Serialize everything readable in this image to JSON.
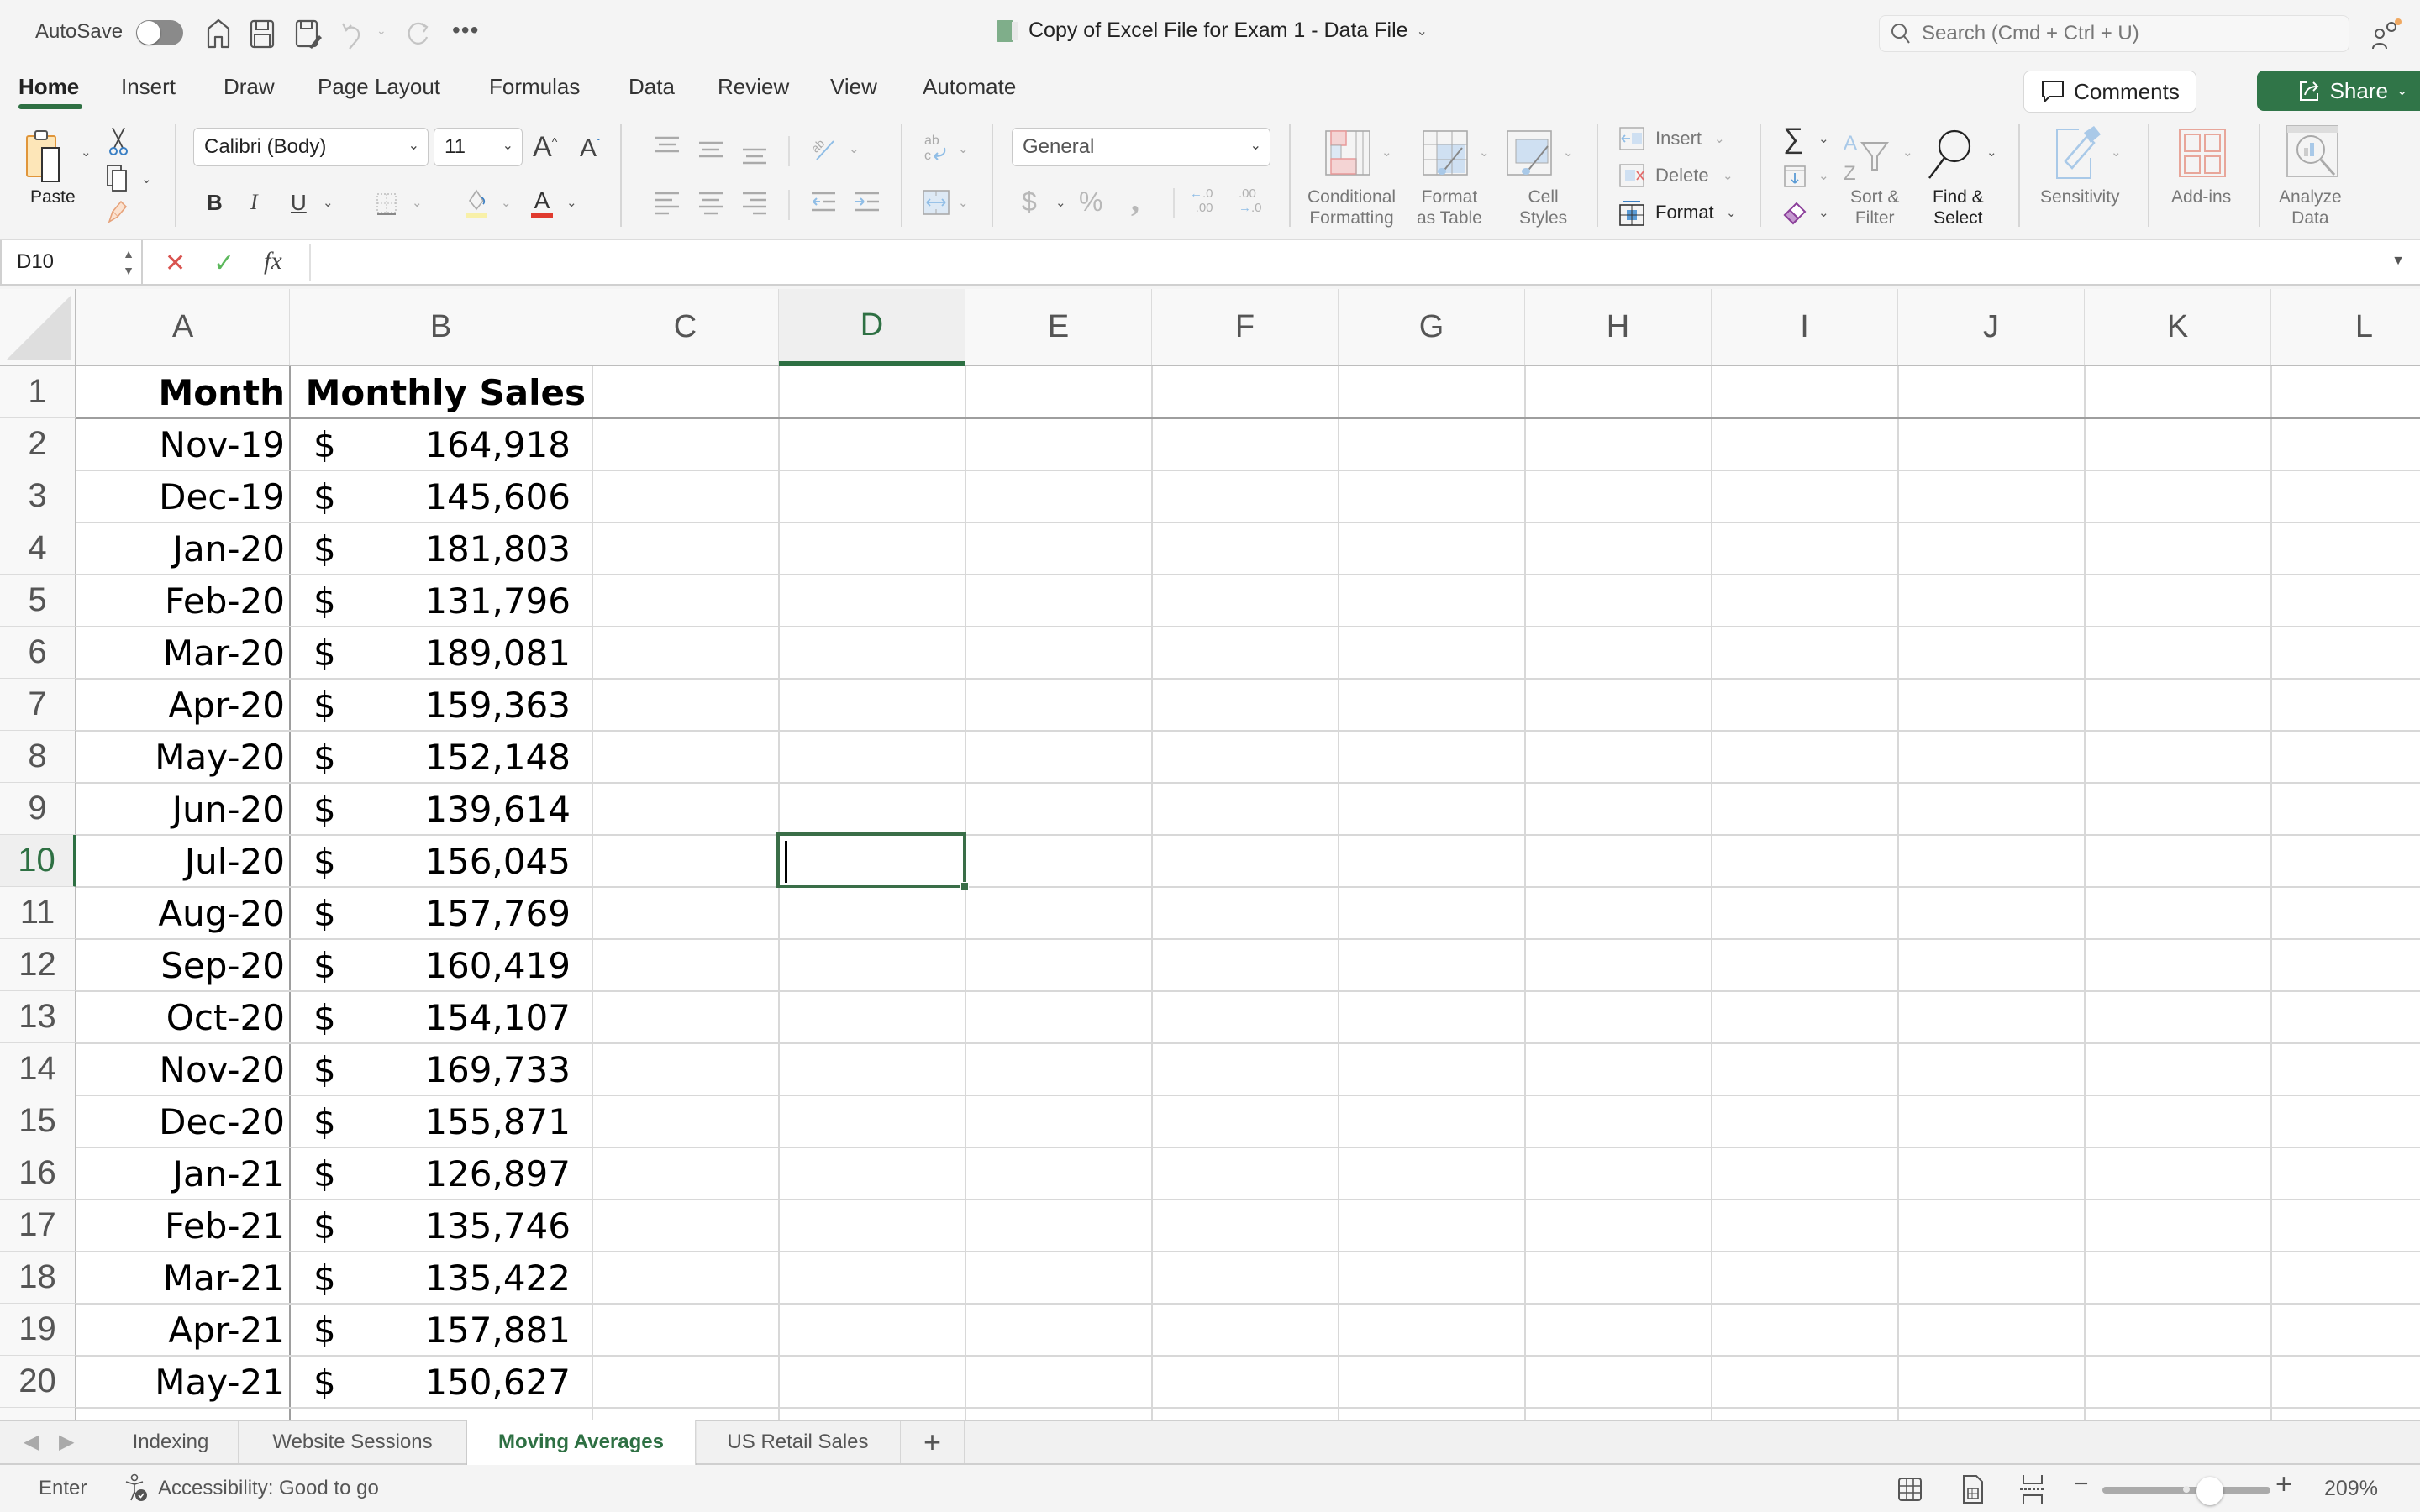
{
  "titlebar": {
    "autosave_label": "AutoSave",
    "autosave_on": false,
    "document_title": "Copy of Excel File for Exam 1 - Data File",
    "search_placeholder": "Search (Cmd + Ctrl + U)"
  },
  "ribbon_tabs": [
    {
      "label": "Home",
      "active": true
    },
    {
      "label": "Insert"
    },
    {
      "label": "Draw"
    },
    {
      "label": "Page Layout"
    },
    {
      "label": "Formulas"
    },
    {
      "label": "Data"
    },
    {
      "label": "Review"
    },
    {
      "label": "View"
    },
    {
      "label": "Automate"
    }
  ],
  "actions": {
    "comments_label": "Comments",
    "share_label": "Share",
    "accent_color": "#307548"
  },
  "ribbon": {
    "paste_label": "Paste",
    "font_name": "Calibri (Body)",
    "font_size": "11",
    "bold": "B",
    "italic": "I",
    "underline": "U",
    "number_format": "General",
    "conditional_formatting": [
      "Conditional",
      "Formatting"
    ],
    "format_as_table": [
      "Format",
      "as Table"
    ],
    "cell_styles": [
      "Cell",
      "Styles"
    ],
    "insert_label": "Insert",
    "delete_label": "Delete",
    "format_label": "Format",
    "sort_filter": [
      "Sort &",
      "Filter"
    ],
    "find_select": [
      "Find &",
      "Select"
    ],
    "sensitivity_label": "Sensitivity",
    "addins_label": "Add-ins",
    "analyze_data": [
      "Analyze",
      "Data"
    ]
  },
  "formula_bar": {
    "name_box": "D10",
    "formula": "",
    "fx_label": "fx"
  },
  "grid": {
    "columns": [
      "A",
      "B",
      "C",
      "D",
      "E",
      "F",
      "G",
      "H",
      "I",
      "J",
      "K",
      "L"
    ],
    "selected_column": "D",
    "selected_row": 10,
    "active_cell": "D10",
    "headers": {
      "A": "Month",
      "B": "Monthly Sales"
    },
    "currency_symbol": "$",
    "rows": [
      {
        "row": 2,
        "month": "Nov-19",
        "sales": "164,918"
      },
      {
        "row": 3,
        "month": "Dec-19",
        "sales": "145,606"
      },
      {
        "row": 4,
        "month": "Jan-20",
        "sales": "181,803"
      },
      {
        "row": 5,
        "month": "Feb-20",
        "sales": "131,796"
      },
      {
        "row": 6,
        "month": "Mar-20",
        "sales": "189,081"
      },
      {
        "row": 7,
        "month": "Apr-20",
        "sales": "159,363"
      },
      {
        "row": 8,
        "month": "May-20",
        "sales": "152,148"
      },
      {
        "row": 9,
        "month": "Jun-20",
        "sales": "139,614"
      },
      {
        "row": 10,
        "month": "Jul-20",
        "sales": "156,045"
      },
      {
        "row": 11,
        "month": "Aug-20",
        "sales": "157,769"
      },
      {
        "row": 12,
        "month": "Sep-20",
        "sales": "160,419"
      },
      {
        "row": 13,
        "month": "Oct-20",
        "sales": "154,107"
      },
      {
        "row": 14,
        "month": "Nov-20",
        "sales": "169,733"
      },
      {
        "row": 15,
        "month": "Dec-20",
        "sales": "155,871"
      },
      {
        "row": 16,
        "month": "Jan-21",
        "sales": "126,897"
      },
      {
        "row": 17,
        "month": "Feb-21",
        "sales": "135,746"
      },
      {
        "row": 18,
        "month": "Mar-21",
        "sales": "135,422"
      },
      {
        "row": 19,
        "month": "Apr-21",
        "sales": "157,881"
      },
      {
        "row": 20,
        "month": "May-21",
        "sales": "150,627"
      }
    ]
  },
  "sheet_tabs": [
    {
      "label": "Indexing"
    },
    {
      "label": "Website Sessions"
    },
    {
      "label": "Moving Averages",
      "active": true
    },
    {
      "label": "US Retail Sales"
    }
  ],
  "add_sheet_label": "+",
  "statusbar": {
    "mode": "Enter",
    "accessibility": "Accessibility: Good to go",
    "zoom_label": "209%",
    "zoom_percent": 209
  }
}
